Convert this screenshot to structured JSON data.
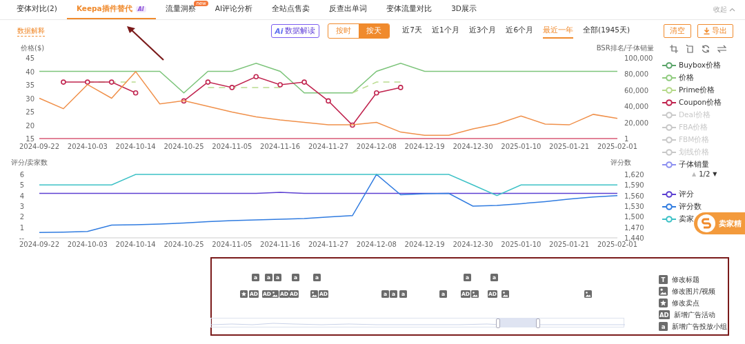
{
  "tabs": [
    {
      "label": "变体对比(2)",
      "selected": false
    },
    {
      "label": "Keepa插件替代",
      "selected": true,
      "badge": {
        "text": "AI",
        "kind": "ai"
      }
    },
    {
      "label": "流量洞察",
      "selected": false,
      "badge": {
        "text": "new",
        "kind": "new"
      }
    },
    {
      "label": "AI评论分析",
      "selected": false
    },
    {
      "label": "全站点售卖",
      "selected": false
    },
    {
      "label": "反查出单词",
      "selected": false
    },
    {
      "label": "变体流量对比",
      "selected": false
    },
    {
      "label": "3D展示",
      "selected": false
    }
  ],
  "collapse": "收起",
  "toolbar": {
    "explain_link": "数据解释",
    "ai_button": {
      "icon": "Ai",
      "label": "数据解读"
    },
    "granularity": [
      {
        "label": "按时",
        "selected": false
      },
      {
        "label": "按天",
        "selected": true
      }
    ],
    "ranges": [
      {
        "label": "近7天",
        "selected": false
      },
      {
        "label": "近1个月",
        "selected": false
      },
      {
        "label": "近3个月",
        "selected": false
      },
      {
        "label": "近6个月",
        "selected": false
      },
      {
        "label": "最近一年",
        "selected": true
      },
      {
        "label": "全部(1945天)",
        "selected": false
      }
    ],
    "clear": "清空",
    "export": "导出"
  },
  "price_chart": {
    "chart_data": {
      "type": "line",
      "ylabel": "价格($)",
      "y2label": "BSR排名/子体销量",
      "categories": [
        "2024-09-22",
        null,
        "2024-10-03",
        null,
        "2024-10-14",
        null,
        "2024-10-25",
        null,
        "2024-11-05",
        null,
        "2024-11-16",
        null,
        "2024-11-27",
        null,
        "2024-12-08",
        null,
        "2024-12-19",
        null,
        "2024-12-30",
        null,
        "2025-01-10",
        null,
        "2025-01-21",
        null,
        "2025-02-01"
      ],
      "ylim": [
        15,
        45
      ],
      "yticks": [
        15,
        20,
        25,
        30,
        35,
        40,
        45
      ],
      "y2lim": [
        0,
        100000
      ],
      "y2ticks": [
        {
          "value": 1,
          "label": "1"
        },
        {
          "value": 20000,
          "label": "20,000"
        },
        {
          "value": 40000,
          "label": "40,000"
        },
        {
          "value": 60000,
          "label": "60,000"
        },
        {
          "value": 80000,
          "label": "80,000"
        },
        {
          "value": 100000,
          "label": "100,000"
        }
      ],
      "series": [
        {
          "color": "#7cc47a",
          "values": [
            40,
            40,
            40,
            40,
            40,
            40,
            32,
            40,
            40,
            43,
            40,
            32,
            32,
            32,
            40,
            43,
            40,
            40,
            40,
            40,
            40,
            40,
            40,
            40,
            40
          ]
        },
        {
          "color": "#b9dc8e",
          "line_style": "dashed",
          "values": [
            null,
            null,
            36,
            36,
            36,
            null,
            null,
            34,
            34,
            34,
            34,
            null,
            null,
            32,
            36,
            36,
            null,
            null,
            null,
            null,
            null,
            null,
            null,
            null,
            null
          ]
        },
        {
          "color": "#c0234e",
          "marker": "circle",
          "values": [
            null,
            36,
            36,
            36,
            32,
            null,
            29,
            36,
            34,
            38,
            35,
            36,
            29,
            20,
            32,
            34,
            null,
            null,
            null,
            null,
            null,
            null,
            null,
            null,
            null
          ]
        },
        {
          "color": "#f0904a",
          "axis": "y2",
          "values": [
            50000,
            37000,
            67000,
            50000,
            83000,
            43000,
            47000,
            40000,
            33000,
            27000,
            23000,
            20000,
            17000,
            17000,
            20000,
            8000,
            4000,
            4000,
            12000,
            18000,
            28000,
            18000,
            17000,
            30000,
            25000
          ]
        },
        {
          "color": "#e0607e",
          "axis": "y2",
          "values": [
            0,
            0,
            0,
            0,
            0,
            0,
            0,
            0,
            0,
            0,
            0,
            0,
            0,
            0,
            0,
            0,
            0,
            0,
            0,
            0,
            0,
            0,
            0,
            0,
            0
          ]
        }
      ]
    }
  },
  "price_legend": [
    {
      "label": "Buybox价格",
      "color": "#5aa469",
      "enabled": true
    },
    {
      "label": "价格",
      "color": "#8fcb7d",
      "enabled": true
    },
    {
      "label": "Prime价格",
      "color": "#b5d98a",
      "enabled": true
    },
    {
      "label": "Coupon价格",
      "color": "#c0234e",
      "enabled": true
    },
    {
      "label": "Deal价格",
      "color": "#c8c8c8",
      "enabled": false
    },
    {
      "label": "FBA价格",
      "color": "#c8c8c8",
      "enabled": false
    },
    {
      "label": "FBM价格",
      "color": "#c8c8c8",
      "enabled": false
    },
    {
      "label": "划线价格",
      "color": "#c8c8c8",
      "enabled": false
    },
    {
      "label": "子体销量",
      "color": "#8c8ff0",
      "enabled": true
    }
  ],
  "legend_pager": {
    "prev": "▲",
    "label": "1/2",
    "next": "▼",
    "prev_disabled": true
  },
  "rating_chart": {
    "chart_data": {
      "type": "line",
      "ylabel": "评分/卖家数",
      "y2label": "评分数",
      "categories": [
        "2024-09-22",
        null,
        "2024-10-03",
        null,
        "2024-10-14",
        null,
        "2024-10-25",
        null,
        "2024-11-05",
        null,
        "2024-11-16",
        null,
        "2024-11-27",
        null,
        "2024-12-08",
        null,
        "2024-12-19",
        null,
        "2024-12-30",
        null,
        "2025-01-10",
        null,
        "2025-01-21",
        null,
        "2025-02-01"
      ],
      "ylim": [
        0,
        6
      ],
      "yticks": [
        {
          "value": 0,
          "label": "--"
        },
        1,
        2,
        3,
        4,
        5,
        6
      ],
      "y2lim": [
        1440,
        1620
      ],
      "y2ticks": [
        {
          "value": 1440,
          "label": "1,440"
        },
        {
          "value": 1470,
          "label": "1,470"
        },
        {
          "value": 1500,
          "label": "1,500"
        },
        {
          "value": 1530,
          "label": "1,530"
        },
        {
          "value": 1560,
          "label": "1,560"
        },
        {
          "value": 1590,
          "label": "1,590"
        },
        {
          "value": 1620,
          "label": "1,620"
        }
      ],
      "series": [
        {
          "color": "#5b3fd1",
          "values": [
            4.2,
            4.2,
            4.2,
            4.2,
            4.2,
            4.2,
            4.2,
            4.2,
            4.2,
            4.2,
            4.3,
            4.2,
            4.2,
            4.2,
            4.2,
            4.2,
            4.2,
            4.2,
            4.2,
            4.2,
            4.2,
            4.2,
            4.2,
            4.2,
            4.2
          ]
        },
        {
          "color": "#2f7be0",
          "axis": "y2",
          "values": [
            1455,
            1456,
            1458,
            1476,
            1477,
            1479,
            1482,
            1486,
            1489,
            1491,
            1493,
            1495,
            1499,
            1503,
            1620,
            1562,
            1565,
            1566,
            1530,
            1532,
            1537,
            1543,
            1550,
            1556,
            1560
          ]
        },
        {
          "color": "#3cc1c6",
          "values": [
            5,
            5,
            5,
            5,
            6,
            6,
            6,
            6,
            6,
            6,
            6,
            6,
            6,
            6,
            6,
            6,
            6,
            6,
            5,
            4,
            5,
            5,
            5,
            5,
            5
          ]
        }
      ]
    }
  },
  "rating_legend": [
    {
      "label": "评分",
      "color": "#5b3fd1"
    },
    {
      "label": "评分数",
      "color": "#2f7be0"
    },
    {
      "label": "卖家",
      "color": "#3cc1c6"
    }
  ],
  "float_badge": "卖家精",
  "events": [
    {
      "bottom": [
        {
          "kind": "star"
        }
      ]
    },
    {
      "top": "a",
      "bottom": [
        {
          "kind": "glyph",
          "glyph": "AD"
        }
      ]
    },
    {
      "top": "a",
      "bottom": [
        {
          "kind": "glyph",
          "glyph": "AD"
        }
      ]
    },
    {
      "top": "a",
      "bottom": [
        {
          "kind": "image"
        },
        {
          "kind": "glyph",
          "glyph": "AD"
        }
      ]
    },
    {
      "top": "a",
      "bottom": [
        {
          "kind": "glyph",
          "glyph": "AD"
        }
      ]
    },
    {
      "top": "a",
      "bottom": [
        {
          "kind": "image"
        },
        {
          "kind": "glyph",
          "glyph": "AD"
        }
      ]
    },
    {
      "bottom": [
        {
          "kind": "glyph",
          "glyph": "a"
        },
        {
          "kind": "glyph",
          "glyph": "a"
        }
      ]
    },
    {
      "bottom": [
        {
          "kind": "glyph",
          "glyph": "a"
        }
      ]
    },
    {
      "bottom": [
        {
          "kind": "glyph",
          "glyph": "a"
        }
      ]
    },
    {
      "top": "a",
      "bottom": [
        {
          "kind": "glyph",
          "glyph": "AD"
        },
        {
          "kind": "image"
        }
      ]
    },
    {
      "top": "a",
      "bottom": [
        {
          "kind": "glyph",
          "glyph": "AD"
        }
      ]
    },
    {
      "bottom": [
        {
          "kind": "image"
        }
      ]
    },
    {
      "bottom": [
        {
          "kind": "image"
        }
      ]
    }
  ],
  "event_legend": [
    {
      "kind": "glyph",
      "glyph": "T",
      "label": "修改标题"
    },
    {
      "kind": "image",
      "label": "修改图片/视频"
    },
    {
      "kind": "star",
      "label": "修改卖点"
    },
    {
      "kind": "glyph",
      "glyph": "AD",
      "label": "新增广告活动"
    },
    {
      "kind": "glyph",
      "glyph": "a",
      "label": "新增广告投放小组"
    }
  ]
}
